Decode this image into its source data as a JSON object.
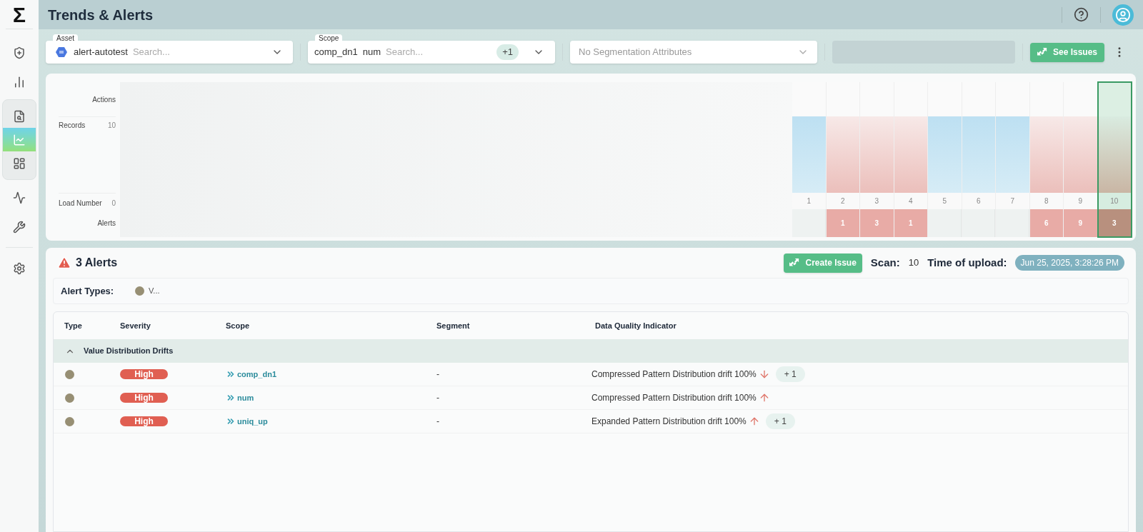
{
  "logo": "Σ",
  "sidebar": {
    "top": [
      {
        "kind": "shield",
        "selected": false
      },
      {
        "kind": "bars",
        "selected": false
      }
    ],
    "group": [
      {
        "kind": "search-report",
        "selected": false
      },
      {
        "kind": "trends",
        "selected": true
      },
      {
        "kind": "dashboard",
        "selected": false
      }
    ],
    "middle": [
      {
        "kind": "monitor",
        "selected": false
      },
      {
        "kind": "wrench",
        "selected": false
      }
    ],
    "bottom": [
      {
        "kind": "settings",
        "selected": false
      }
    ]
  },
  "header": {
    "title": "Trends & Alerts"
  },
  "filters": {
    "asset": {
      "label": "Asset",
      "value": "alert-autotest",
      "placeholder": "Search..."
    },
    "scope": {
      "label": "Scope",
      "values": [
        "comp_dn1",
        "num"
      ],
      "placeholder": "Search...",
      "more": "+1"
    },
    "segmentation": {
      "placeholder": "No Segmentation Attributes"
    },
    "see_issues": "See Issues"
  },
  "chart": {
    "row_labels": [
      {
        "label": "Actions"
      },
      {
        "label": "Records",
        "value": "10"
      },
      {
        "label": "Load Number",
        "value": "0"
      },
      {
        "label": "Alerts"
      }
    ],
    "columns": [
      {
        "load": "1",
        "kind": "normal",
        "selected": false
      },
      {
        "load": "2",
        "kind": "alert",
        "alerts": "1",
        "selected": false
      },
      {
        "load": "3",
        "kind": "alert",
        "alerts": "3",
        "selected": false
      },
      {
        "load": "4",
        "kind": "alert",
        "alerts": "1",
        "selected": false
      },
      {
        "load": "5",
        "kind": "normal",
        "selected": false
      },
      {
        "load": "6",
        "kind": "normal",
        "selected": false
      },
      {
        "load": "7",
        "kind": "normal",
        "selected": false
      },
      {
        "load": "8",
        "kind": "alert",
        "alerts": "6",
        "selected": false
      },
      {
        "load": "9",
        "kind": "alert",
        "alerts": "9",
        "selected": false
      },
      {
        "load": "10",
        "kind": "alert",
        "alerts": "3",
        "selected": true
      }
    ]
  },
  "alerts": {
    "title": "3 Alerts",
    "create_issue": "Create Issue",
    "scan_label": "Scan:",
    "scan": "10",
    "upload_label": "Time of upload:",
    "upload": "Jun 25, 2025, 3:28:26 PM",
    "types_label": "Alert Types:",
    "types": [
      {
        "label": "V...",
        "color": "#978f74"
      }
    ],
    "table": {
      "columns": [
        "Type",
        "Severity",
        "Scope",
        "Segment",
        "Data Quality Indicator"
      ],
      "groups": [
        {
          "label": "Value Distribution Drifts",
          "expanded": true,
          "rows": [
            {
              "color": "#978f74",
              "severity": "High",
              "scope": "comp_dn1",
              "segment": "-",
              "indicator": "Compressed Pattern Distribution drift 100%",
              "kind": "down",
              "more": "+ 1"
            },
            {
              "color": "#978f74",
              "severity": "High",
              "scope": "num",
              "segment": "-",
              "indicator": "Compressed Pattern Distribution drift 100%",
              "kind": "up"
            },
            {
              "color": "#978f74",
              "severity": "High",
              "scope": "uniq_up",
              "segment": "-",
              "indicator": "Expanded Pattern Distribution drift 100%",
              "kind": "up",
              "more": "+ 1"
            }
          ]
        }
      ]
    }
  }
}
